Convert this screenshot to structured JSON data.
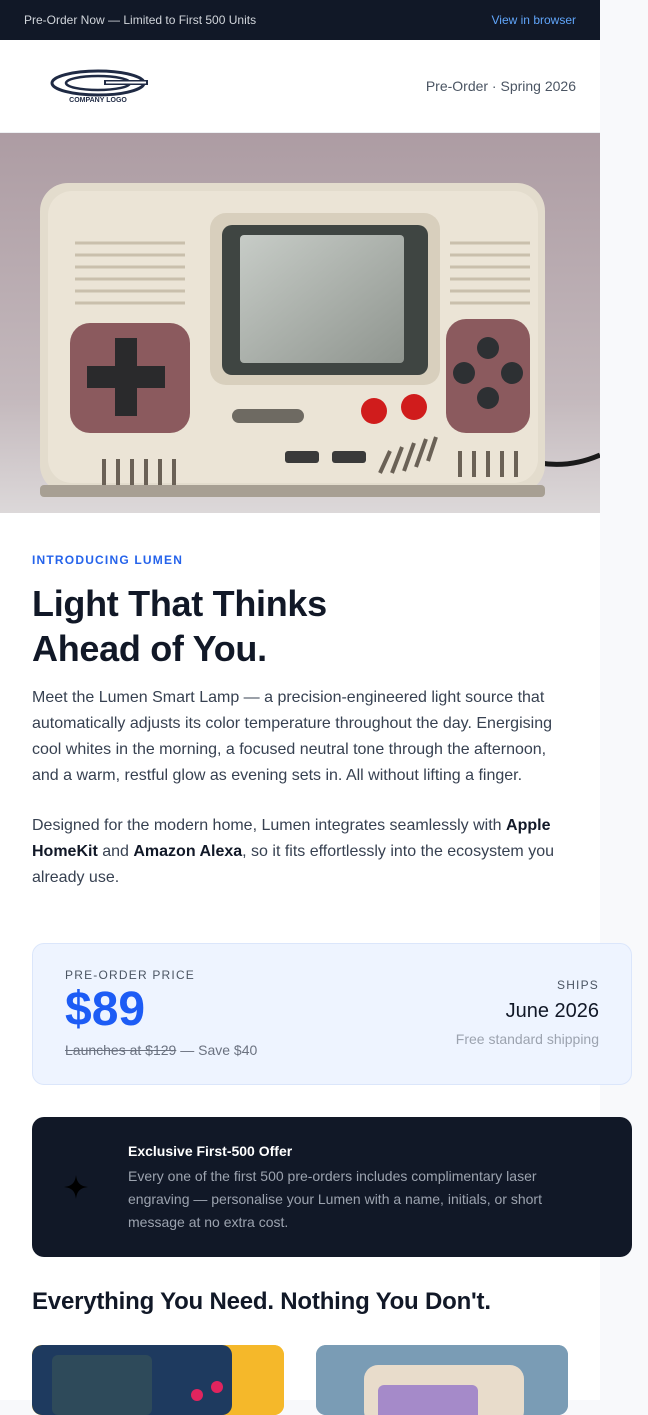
{
  "topbar": {
    "preorder_text": "Pre-Order Now — Limited to First 500 Units",
    "view_link": "View in browser"
  },
  "header": {
    "logo_text": "COMPANY LOGO",
    "tagline": "Pre-Order · Spring 2026"
  },
  "hero": {
    "image_label": "retro-handheld-lamp-photo"
  },
  "intro": {
    "eyebrow": "INTRODUCING LUMEN",
    "headline_line1": "Light That Thinks",
    "headline_line2": "Ahead of You.",
    "paragraph1": "Meet the Lumen Smart Lamp — a precision-engineered light source that automatically adjusts its color temperature throughout the day. Energising cool whites in the morning, a focused neutral tone through the afternoon, and a warm, restful glow as evening sets in. All without lifting a finger.",
    "paragraph2_start": "Designed for the modern home, Lumen integrates seamlessly with ",
    "paragraph2_brand1": "Apple HomeKit",
    "paragraph2_mid": " and ",
    "paragraph2_brand2": "Amazon Alexa",
    "paragraph2_end": ", so it fits effortlessly into the ecosystem you already use."
  },
  "pricing": {
    "label": "PRE-ORDER PRICE",
    "price": "$89",
    "launch_price": "Launches at $129",
    "savings": " — Save $40",
    "ships_label": "SHIPS",
    "ships_date": "June 2026",
    "shipping_note": "Free standard shipping"
  },
  "offer": {
    "icon": "sparkle-icon",
    "title": "Exclusive First-500 Offer",
    "body": "Every one of the first 500 pre-orders includes complimentary laser engraving — personalise your Lumen with a name, initials, or short message at no extra cost."
  },
  "features": {
    "heading": "Everything You Need. Nothing You Don't."
  },
  "colors": {
    "accent": "#1d5cf5",
    "dark": "#111827",
    "eyebrow": "#2563eb"
  }
}
